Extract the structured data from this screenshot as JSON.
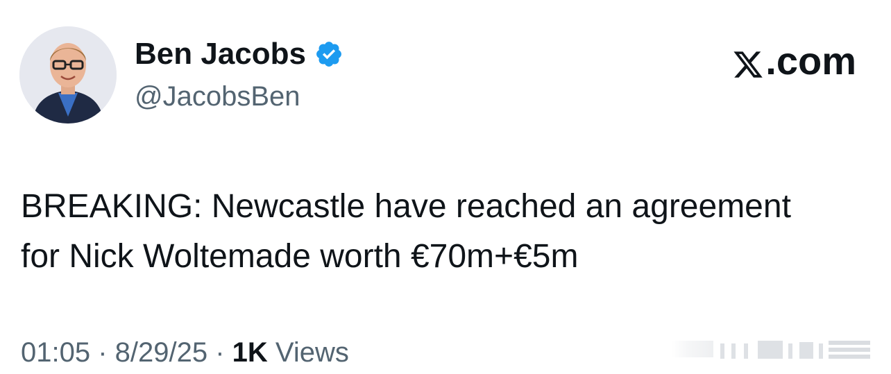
{
  "author": {
    "display_name": "Ben Jacobs",
    "handle": "@JacobsBen",
    "verified_icon": "verified-badge-icon",
    "verified_color": "#1d9bf0"
  },
  "brand": {
    "logo_text": ".com",
    "logo_icon": "x-logo-icon"
  },
  "tweet": {
    "line1": "BREAKING: Newcastle have reached an agreement",
    "line2": "for Nick Woltemade worth €70m+€5m"
  },
  "meta": {
    "time": "01:05",
    "separator1": " · ",
    "date": "8/29/25",
    "separator2": " · ",
    "views_count": "1K",
    "views_label": " Views"
  },
  "colors": {
    "text_primary": "#0f1419",
    "text_secondary": "#536471",
    "accent": "#1d9bf0"
  }
}
